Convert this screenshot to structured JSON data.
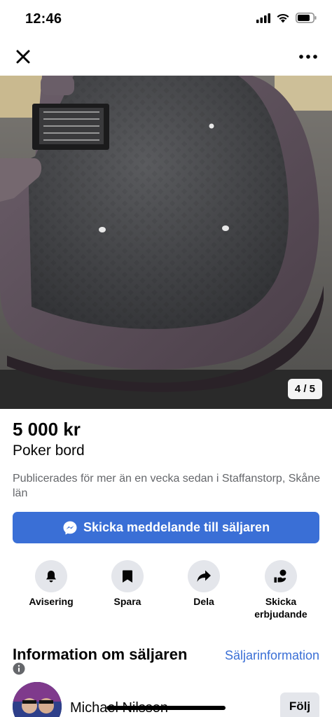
{
  "status_bar": {
    "time": "12:46"
  },
  "photo": {
    "counter": "4 / 5"
  },
  "listing": {
    "price": "5 000 kr",
    "title": "Poker bord",
    "meta": "Publicerades för mer än en vecka sedan i Staffanstorp, Skåne län"
  },
  "message_button": {
    "label": "Skicka meddelande till säljaren"
  },
  "actions": [
    {
      "label": "Avisering",
      "icon": "bell-icon"
    },
    {
      "label": "Spara",
      "icon": "bookmark-icon"
    },
    {
      "label": "Dela",
      "icon": "share-icon"
    },
    {
      "label": "Skicka\nerbjudande",
      "icon": "offer-icon"
    }
  ],
  "seller": {
    "heading": "Information om säljaren",
    "info_link": "Säljarinformation",
    "name": "Michael Nilsson",
    "follow_label": "Följ"
  },
  "colors": {
    "accent": "#3a6fd6",
    "button_gray": "#e4e6eb",
    "meta_text": "#65676b"
  }
}
